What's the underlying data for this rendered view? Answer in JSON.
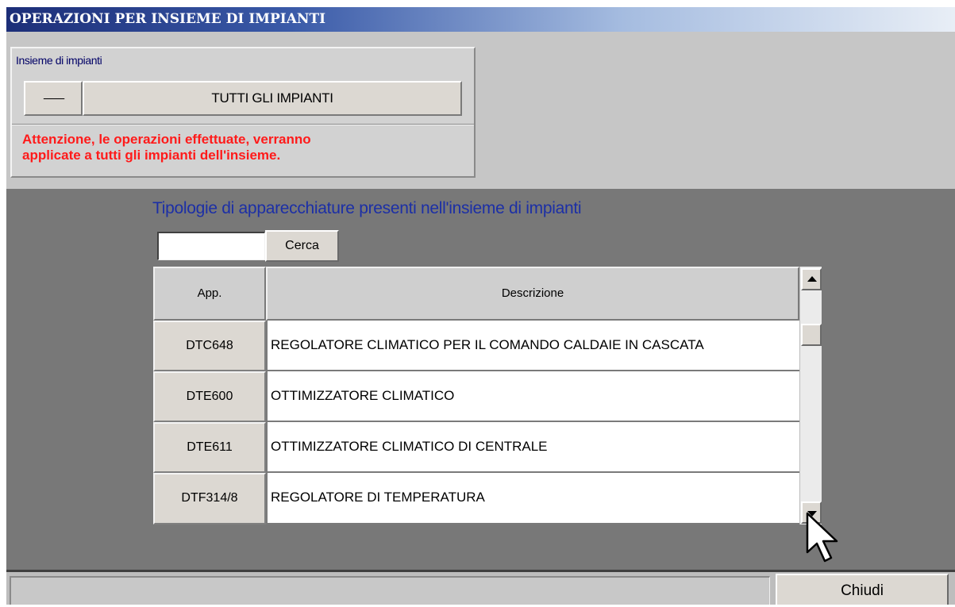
{
  "window": {
    "title": "OPERAZIONI PER INSIEME DI IMPIANTI"
  },
  "impianti_group": {
    "label": "Insieme di impianti",
    "select_button": "-----------",
    "current_set": "TUTTI GLI IMPIANTI",
    "warning_line1": "Attenzione, le operazioni effettuate, verranno",
    "warning_line2": "applicate a tutti gli impianti dell'insieme."
  },
  "apparecchiature": {
    "title": "Tipologie di apparecchiature presenti nell'insieme di impianti",
    "search_value": "",
    "search_button": "Cerca",
    "columns": [
      "App.",
      "Descrizione"
    ],
    "rows": [
      {
        "code": "DTC648",
        "description": "REGOLATORE CLIMATICO PER IL COMANDO CALDAIE IN CASCATA"
      },
      {
        "code": "DTE600",
        "description": "OTTIMIZZATORE CLIMATICO"
      },
      {
        "code": "DTE611",
        "description": "OTTIMIZZATORE CLIMATICO DI CENTRALE"
      },
      {
        "code": "DTF314/8",
        "description": "REGOLATORE DI TEMPERATURA"
      }
    ]
  },
  "footer": {
    "close_button": "Chiudi"
  },
  "icons": {
    "scroll_up": "scroll-up-arrow-icon",
    "scroll_down": "scroll-down-arrow-icon",
    "pointer": "mouse-pointer-icon"
  },
  "colors": {
    "warning": "#ff1a1a",
    "section_title": "#1c2fa6",
    "title_bar": "#1c2e78"
  }
}
